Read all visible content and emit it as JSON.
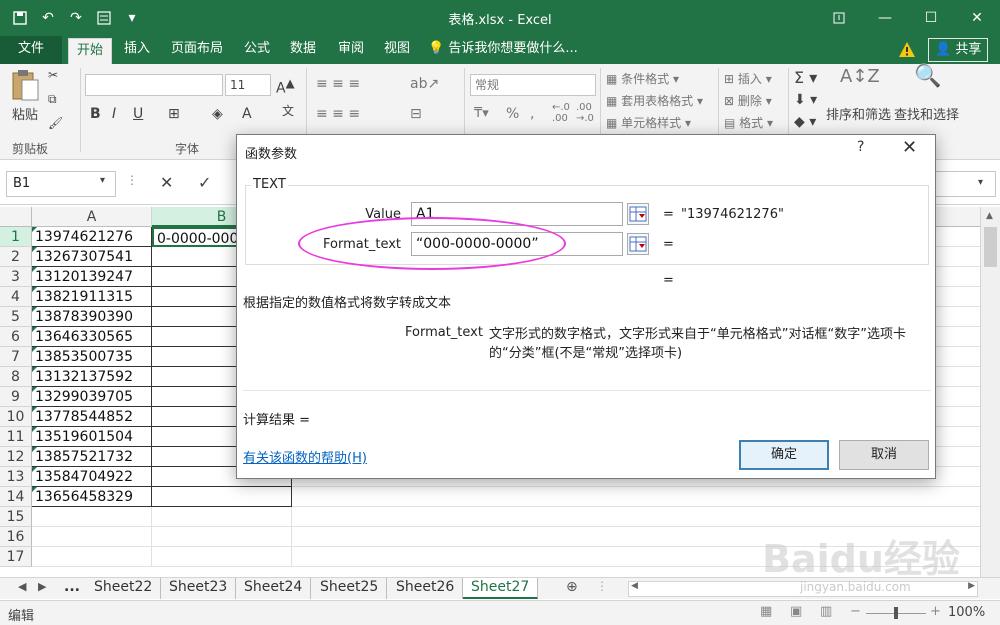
{
  "window": {
    "title": "表格.xlsx - Excel"
  },
  "ribbon_tabs": [
    "文件",
    "开始",
    "插入",
    "页面布局",
    "公式",
    "数据",
    "审阅",
    "视图"
  ],
  "tell_me": "告诉我你想要做什么...",
  "share_label": "共享",
  "ribbon": {
    "paste": "粘贴",
    "clipboard": "剪贴板",
    "font": "字体",
    "font_size": "11",
    "bold": "B",
    "italic": "I",
    "underline": "U",
    "number_format": "常规",
    "percent": "%",
    "cond_format": "条件格式",
    "table_format": "套用表格格式",
    "cell_style": "单元格样式",
    "insert": "插入",
    "delete": "删除",
    "format": "格式",
    "sort_filter": "排序和筛选",
    "find_select": "查找和选择"
  },
  "formula_bar": {
    "name_box": "B1"
  },
  "columns": [
    "A",
    "B"
  ],
  "rows": [
    "1",
    "2",
    "3",
    "4",
    "5",
    "6",
    "7",
    "8",
    "9",
    "10",
    "11",
    "12",
    "13",
    "14",
    "15",
    "16",
    "17"
  ],
  "col_a": [
    "13974621276",
    "13267307541",
    "13120139247",
    "13821911315",
    "13878390390",
    "13646330565",
    "13853500735",
    "13132137592",
    "13299039705",
    "13778544852",
    "13519601504",
    "13857521732",
    "13584704922",
    "13656458329"
  ],
  "b1_value": "0-0000-000",
  "sheet_tabs": [
    "...",
    "Sheet22",
    "Sheet23",
    "Sheet24",
    "Sheet25",
    "Sheet26",
    "Sheet27"
  ],
  "status": {
    "mode": "编辑",
    "zoom": "100%"
  },
  "dialog": {
    "title": "函数参数",
    "help_btn": "?",
    "function_name": "TEXT",
    "args": [
      {
        "label": "Value",
        "value": "A1",
        "result": "\"13974621276\""
      },
      {
        "label": "Format_text",
        "value": "“000-0000-0000”",
        "result": ""
      }
    ],
    "eq": "=",
    "description": "根据指定的数值格式将数字转成文本",
    "arg_desc_name": "Format_text",
    "arg_desc_text": "文字形式的数字格式，文字形式来自于“单元格格式”对话框“数字”选项卡的“分类”框(不是“常规”选择项卡)",
    "calc_result": "计算结果 =",
    "help_link": "有关该函数的帮助(H)",
    "ok": "确定",
    "cancel": "取消"
  },
  "watermark": {
    "main": "Baidu经验",
    "sub": "jingyan.baidu.com"
  },
  "colors": {
    "excel_green": "#217346",
    "highlight": "#e83be0",
    "link": "#0563c1"
  }
}
